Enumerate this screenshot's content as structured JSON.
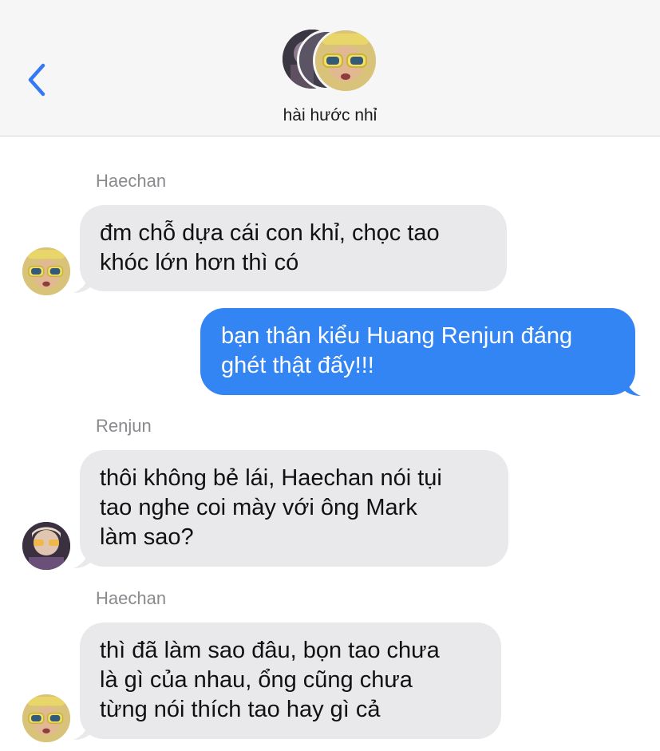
{
  "header": {
    "title": "hài hước nhỉ",
    "back_icon": "chevron-left-icon",
    "accent": "#3478f6"
  },
  "messages": [
    {
      "sender": "Haechan",
      "direction": "incoming",
      "text": "đm chỗ dựa cái con khỉ, chọc tao\nkhóc lớn hơn thì có"
    },
    {
      "sender": "",
      "direction": "outgoing",
      "text": "bạn thân kiểu Huang Renjun đáng\nghét thật đấy!!!"
    },
    {
      "sender": "Renjun",
      "direction": "incoming",
      "text": "thôi không bẻ lái, Haechan nói tụi\ntao nghe coi mày với ông Mark\nlàm sao?"
    },
    {
      "sender": "Haechan",
      "direction": "incoming",
      "text": "thì đã làm sao đâu, bọn tao chưa\nlà gì của nhau, ổng cũng chưa\ntừng nói thích tao hay gì cả"
    }
  ],
  "colors": {
    "incoming_bubble": "#e9e9eb",
    "outgoing_bubble": "#3485f4",
    "header_bg": "#f6f6f6",
    "sender_label": "#8a8a8e"
  }
}
